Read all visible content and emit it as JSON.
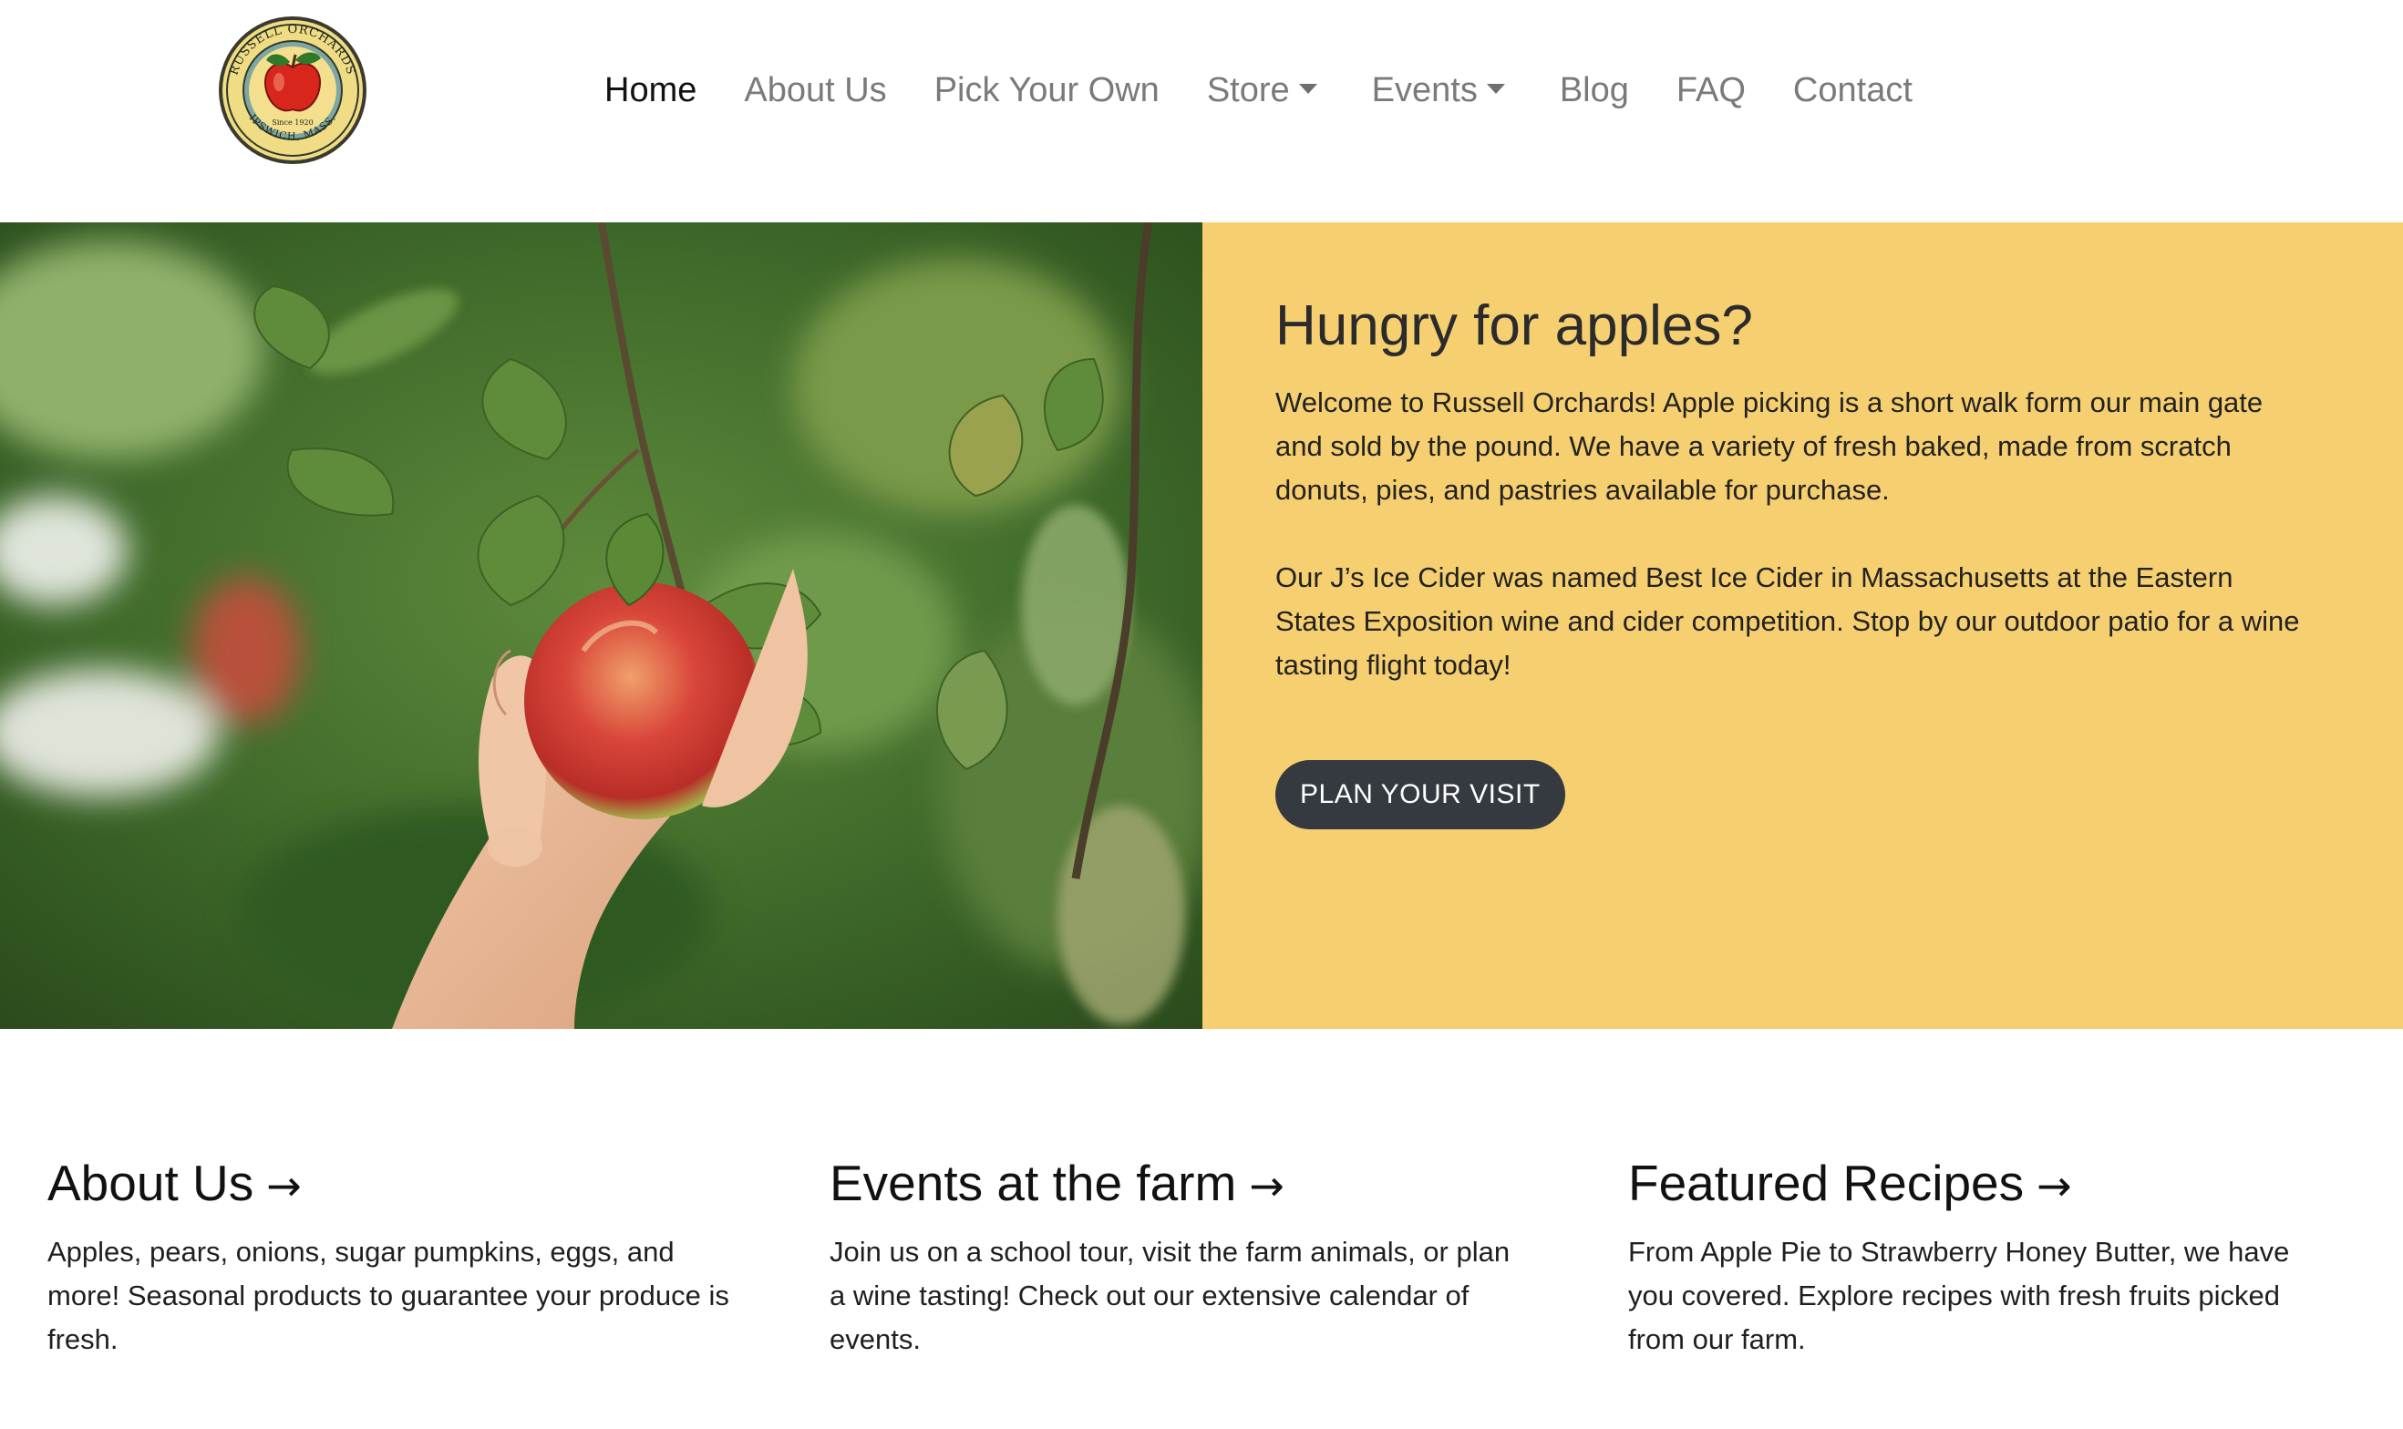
{
  "brand": {
    "logo_top_text": "RUSSELL ORCHARDS",
    "logo_since_text": "Since 1920",
    "logo_bottom_text": "IPSWICH, MASS."
  },
  "nav": {
    "items": [
      {
        "label": "Home",
        "active": true,
        "dropdown": false
      },
      {
        "label": "About Us",
        "active": false,
        "dropdown": false
      },
      {
        "label": "Pick Your Own",
        "active": false,
        "dropdown": false
      },
      {
        "label": "Store",
        "active": false,
        "dropdown": true
      },
      {
        "label": "Events",
        "active": false,
        "dropdown": true
      },
      {
        "label": "Blog",
        "active": false,
        "dropdown": false
      },
      {
        "label": "FAQ",
        "active": false,
        "dropdown": false
      },
      {
        "label": "Contact",
        "active": false,
        "dropdown": false
      }
    ]
  },
  "hero": {
    "title": "Hungry for apples?",
    "paragraph1": "Welcome to Russell Orchards! Apple picking is a short walk form our main gate and sold by the pound. We have a variety of fresh baked, made from scratch donuts, pies, and pastries available for purchase.",
    "paragraph2": "Our J’s Ice Cider was named Best Ice Cider in Massachusetts at the Eastern States Exposition wine and cider competition. Stop by our outdoor patio for a wine tasting flight today!",
    "cta_label": "PLAN YOUR VISIT",
    "panel_color": "#f6cf70",
    "button_color": "#343a40"
  },
  "cards": [
    {
      "title": "About Us",
      "arrow": "→",
      "text": "Apples, pears, onions, sugar pumpkins, eggs, and more! Seasonal products to guarantee your produce is fresh."
    },
    {
      "title": "Events at the farm",
      "arrow": "→",
      "text": "Join us on a school tour, visit the farm animals, or plan a wine tasting! Check out our extensive calendar of events."
    },
    {
      "title": "Featured Recipes",
      "arrow": "→",
      "text": "From Apple Pie to Strawberry Honey Butter, we have you covered. Explore recipes with fresh fruits picked from our farm."
    }
  ]
}
